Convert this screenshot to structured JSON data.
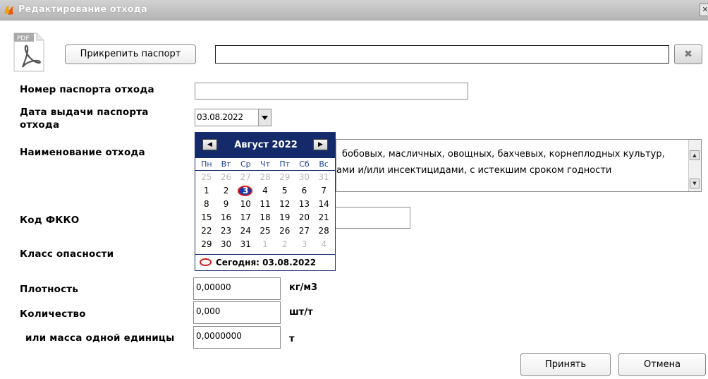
{
  "window": {
    "title": "Редактирование отхода",
    "close_glyph": "✕"
  },
  "attach": {
    "pdf_label": "PDF",
    "button_label": "Прикрепить паспорт",
    "file_value": "",
    "clear_glyph": "✖"
  },
  "form": {
    "passport_number": {
      "label": "Номер паспорта отхода",
      "value": ""
    },
    "passport_date": {
      "label_line1": "Дата выдачи паспорта",
      "label_line2": "отхода",
      "value": "03.08.2022"
    },
    "waste_name": {
      "label": "Наименование отхода",
      "value_line1": "бобовых, масличных, овощных, бахчевых, корнеплодных культур,",
      "value_line2": "ами и/или инсектицидами, с истекшим сроком годности"
    },
    "fkko_code": {
      "label": "Код ФККО",
      "value": ""
    },
    "hazard_class": {
      "label": "Класс опасности"
    },
    "density": {
      "label": "Плотность",
      "value": "0,00000",
      "unit": "кг/м3"
    },
    "quantity": {
      "label": "Количество",
      "value": "0,000",
      "unit": "шт/т"
    },
    "unit_mass": {
      "label": "или масса одной единицы",
      "value": "0,0000000",
      "unit": "т"
    }
  },
  "calendar": {
    "month_label": "Август 2022",
    "prev_glyph": "◀",
    "next_glyph": "▶",
    "weekdays": [
      "Пн",
      "Вт",
      "Ср",
      "Чт",
      "Пт",
      "Сб",
      "Вс"
    ],
    "days": [
      {
        "d": "25",
        "other": true
      },
      {
        "d": "26",
        "other": true
      },
      {
        "d": "27",
        "other": true
      },
      {
        "d": "28",
        "other": true
      },
      {
        "d": "29",
        "other": true
      },
      {
        "d": "30",
        "other": true
      },
      {
        "d": "31",
        "other": true
      },
      {
        "d": "1"
      },
      {
        "d": "2"
      },
      {
        "d": "3",
        "selected": true
      },
      {
        "d": "4"
      },
      {
        "d": "5"
      },
      {
        "d": "6"
      },
      {
        "d": "7"
      },
      {
        "d": "8"
      },
      {
        "d": "9"
      },
      {
        "d": "10"
      },
      {
        "d": "11"
      },
      {
        "d": "12"
      },
      {
        "d": "13"
      },
      {
        "d": "14"
      },
      {
        "d": "15"
      },
      {
        "d": "16"
      },
      {
        "d": "17"
      },
      {
        "d": "18"
      },
      {
        "d": "19"
      },
      {
        "d": "20"
      },
      {
        "d": "21"
      },
      {
        "d": "22"
      },
      {
        "d": "23"
      },
      {
        "d": "24"
      },
      {
        "d": "25"
      },
      {
        "d": "26"
      },
      {
        "d": "27"
      },
      {
        "d": "28"
      },
      {
        "d": "29"
      },
      {
        "d": "30"
      },
      {
        "d": "31"
      },
      {
        "d": "1",
        "other": true
      },
      {
        "d": "2",
        "other": true
      },
      {
        "d": "3",
        "other": true
      },
      {
        "d": "4",
        "other": true
      }
    ],
    "today_label": "Сегодня: 03.08.2022"
  },
  "actions": {
    "accept_label": "Принять",
    "cancel_label": "Отмена"
  },
  "colors": {
    "calendar_header": "#142a6b",
    "selected_ring": "#d21c1c"
  }
}
